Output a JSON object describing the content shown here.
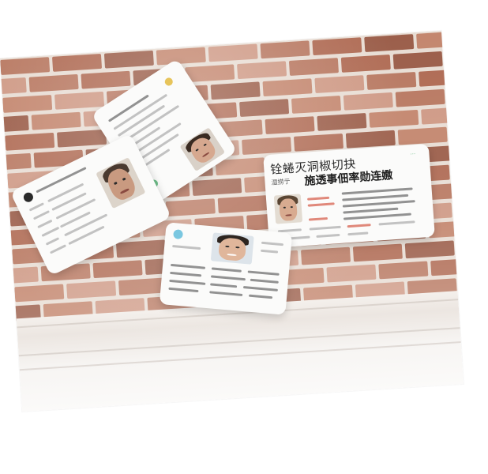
{
  "scene": {
    "description_colors": {
      "brick": "#b97a63",
      "brick_dark": "#9c5f4b",
      "brick_light": "#cf9a86",
      "trim": "#f4f0ec",
      "card": "#fbfbfa",
      "accent_green": "#6fbf8a",
      "accent_red": "#d96b5a"
    }
  },
  "cards": {
    "large_card": {
      "title": "铨蜷灭洞椒切抉",
      "subtitle_small": "湿捞亍",
      "headline": "施透事佃率勋连嫐",
      "corner_mark": "···"
    }
  }
}
